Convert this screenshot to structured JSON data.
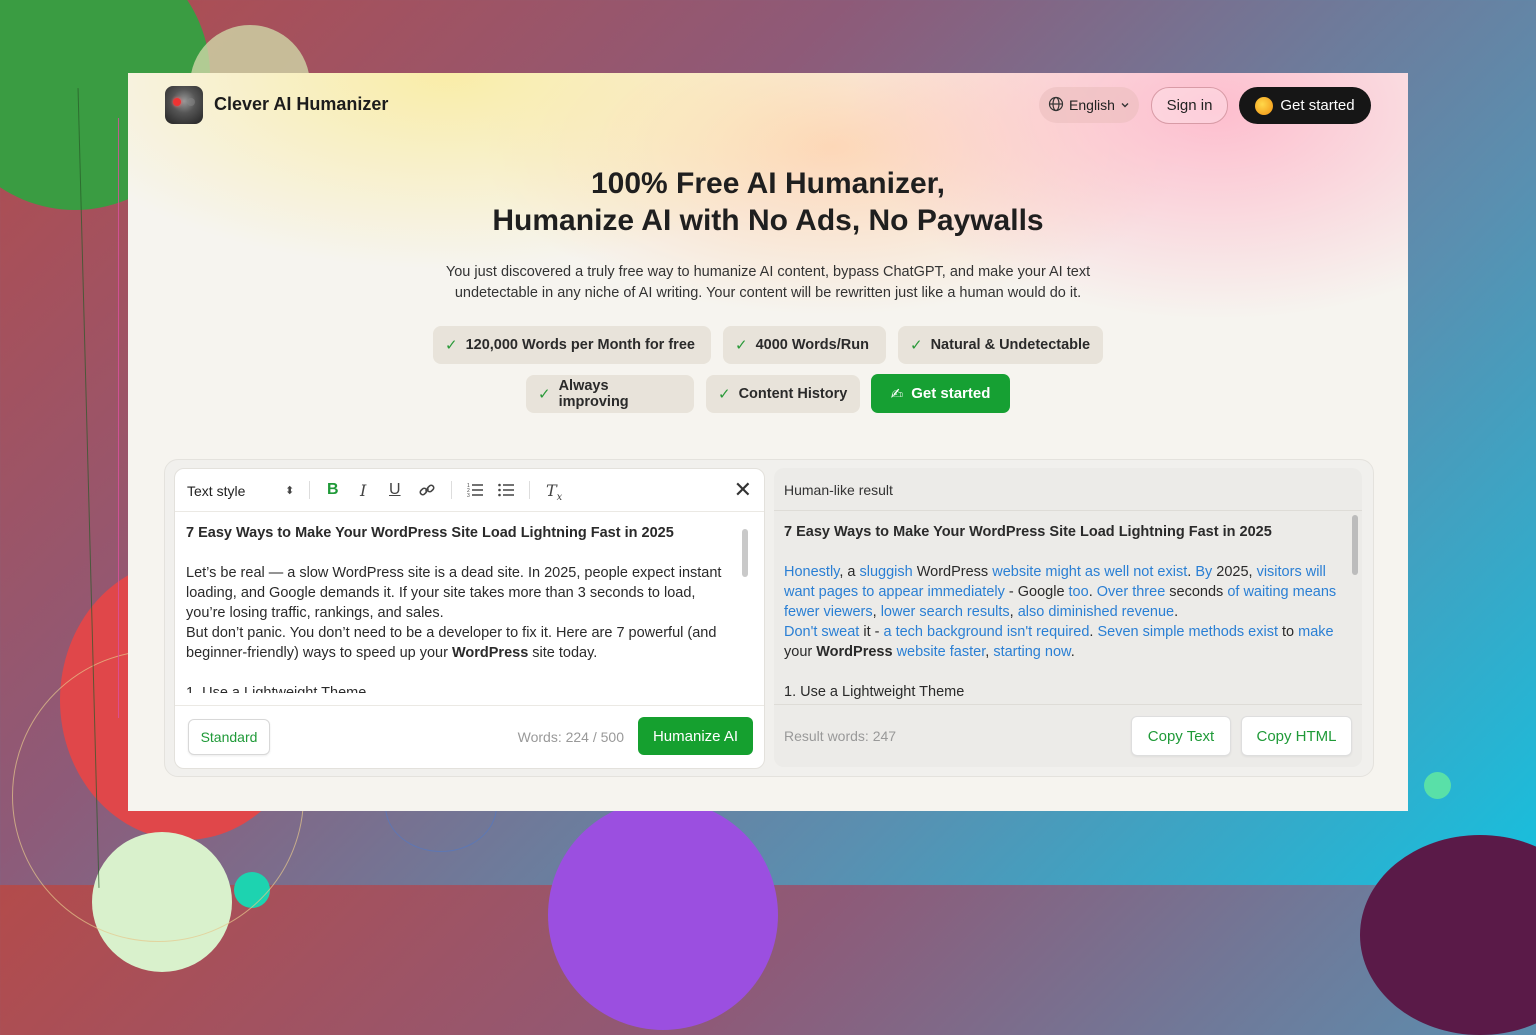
{
  "header": {
    "brand": "Clever AI Humanizer",
    "language": "English",
    "sign_in": "Sign in",
    "get_started": "Get started"
  },
  "hero": {
    "title_line1": "100% Free AI Humanizer,",
    "title_line2": "Humanize AI with No Ads, No Paywalls",
    "subtitle_line1": "You just discovered a truly free way to humanize AI content, bypass ChatGPT, and make your AI text",
    "subtitle_line2": "undetectable in any niche of AI writing. Your content will be rewritten just like a human would do it."
  },
  "features": [
    "120,000 Words per Month for free",
    "4000 Words/Run",
    "Natural & Undetectable",
    "Always improving",
    "Content History"
  ],
  "cta": {
    "label": "Get started",
    "emoji": "✍"
  },
  "editor": {
    "text_style": "Text style",
    "heading": "7 Easy Ways to Make Your WordPress Site Load Lightning Fast in 2025",
    "p1": "Let’s be real — a slow WordPress site is a dead site. In 2025, people expect instant loading, and Google demands it. If your site takes more than 3 seconds to load, you’re losing traffic, rankings, and sales.",
    "p2_before": "But don’t panic. You don’t need to be a developer to fix it. Here are 7 powerful (and beginner-friendly) ways to speed up your ",
    "p2_bold": "WordPress",
    "p2_after": " site today.",
    "p3_partial": "1. Use a Lightweight Theme",
    "mode": "Standard",
    "word_count": "Words: 224 / 500",
    "humanize": "Humanize AI"
  },
  "result": {
    "title": "Human-like result",
    "heading": "7 Easy Ways to Make Your WordPress Site Load Lightning Fast in 2025",
    "list_item": "1. Use a Lightweight Theme",
    "result_words": "Result words: 247",
    "copy_text": "Copy Text",
    "copy_html": "Copy HTML"
  },
  "colors": {
    "accent_green": "#16a033",
    "highlight_blue": "#2a7fd4",
    "dark_button": "#161616"
  }
}
